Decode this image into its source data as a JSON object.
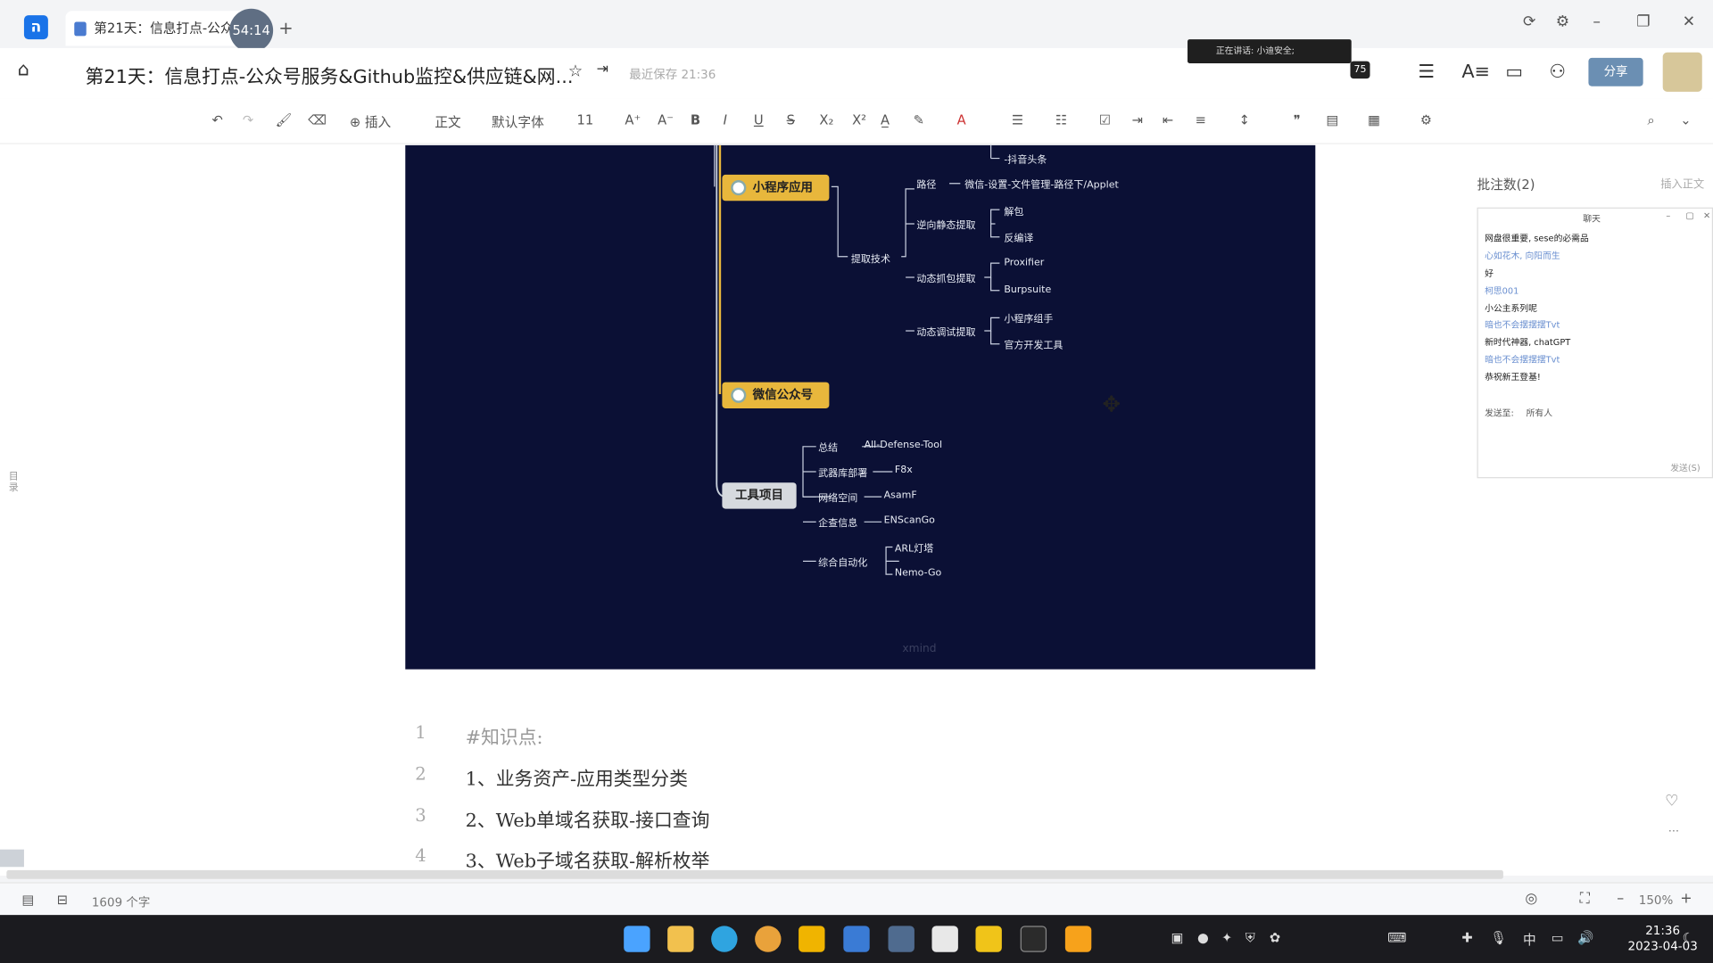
{
  "window": {
    "tab_title": "第21天：信息打点-公众...",
    "timer": "54:14"
  },
  "header": {
    "doc_title": "第21天：信息打点-公众号服务&Github监控&供应链&网...",
    "save_status": "最近保存 21:36",
    "talking_label": "正在讲话: 小迪安全;",
    "viewer_count": "75",
    "share_label": "分享"
  },
  "toolbar": {
    "insert_label": "插入",
    "style_label": "正文",
    "font_label": "默认字体",
    "size_label": "11"
  },
  "mindmap": {
    "top_leaf": "-抖音头条",
    "node_miniapp": "小程序应用",
    "node_wechat": "微信公众号",
    "node_tools": "工具项目",
    "path_label": "路径",
    "path_value": "微信-设置-文件管理-路径下/Applet",
    "extract_tech": "提取技术",
    "reverse_static": "逆向静态提取",
    "unpack": "解包",
    "decompile": "反编译",
    "dynamic_capture": "动态抓包提取",
    "proxifier": "Proxifier",
    "burpsuite": "Burpsuite",
    "dynamic_debug": "动态调试提取",
    "miniapp_helper": "小程序组手",
    "official_tool": "官方开发工具",
    "summary": "总结",
    "summary_val": "All-Defense-Tool",
    "weapon": "武器库部署",
    "weapon_val": "F8x",
    "cyberspace": "网络空间",
    "cyberspace_val": "AsamF",
    "enterprise": "企查信息",
    "enterprise_val": "ENScanGo",
    "automation": "综合自动化",
    "arl": "ARL灯塔",
    "nemo": "Nemo-Go",
    "watermark": "xmind"
  },
  "document": {
    "lines": [
      {
        "num": "1",
        "text": "#知识点:"
      },
      {
        "num": "2",
        "text": "1、业务资产-应用类型分类"
      },
      {
        "num": "3",
        "text": "2、Web单域名获取-接口查询"
      },
      {
        "num": "4",
        "text": "3、Web子域名获取-解析枚举"
      }
    ]
  },
  "comments": {
    "title": "批注数(2)",
    "insert_label": "插入正文",
    "chat_title": "聊天",
    "messages": [
      {
        "text": "网盘很重要, sese的必需品",
        "color": "#222"
      },
      {
        "text": "心如花木, 向阳而生",
        "color": "#6a8fd0"
      },
      {
        "text": "好",
        "color": "#222"
      },
      {
        "text": "柯思001",
        "color": "#6a8fd0"
      },
      {
        "text": "小公主系列呢",
        "color": "#222"
      },
      {
        "text": "暗也不会摆摆摆Tvt",
        "color": "#6a8fd0"
      },
      {
        "text": "新时代神器, chatGPT",
        "color": "#222"
      },
      {
        "text": "暗也不会摆摆摆Tvt",
        "color": "#6a8fd0"
      },
      {
        "text": "恭祝新王登基!",
        "color": "#222"
      }
    ],
    "send_to": "发送至:",
    "recipients": "所有人",
    "send_label": "发送(S)"
  },
  "statusbar": {
    "word_count": "1609 个字",
    "zoom": "150%"
  },
  "taskbar": {
    "time": "21:36",
    "date": "2023-04-03",
    "ime": "中"
  }
}
